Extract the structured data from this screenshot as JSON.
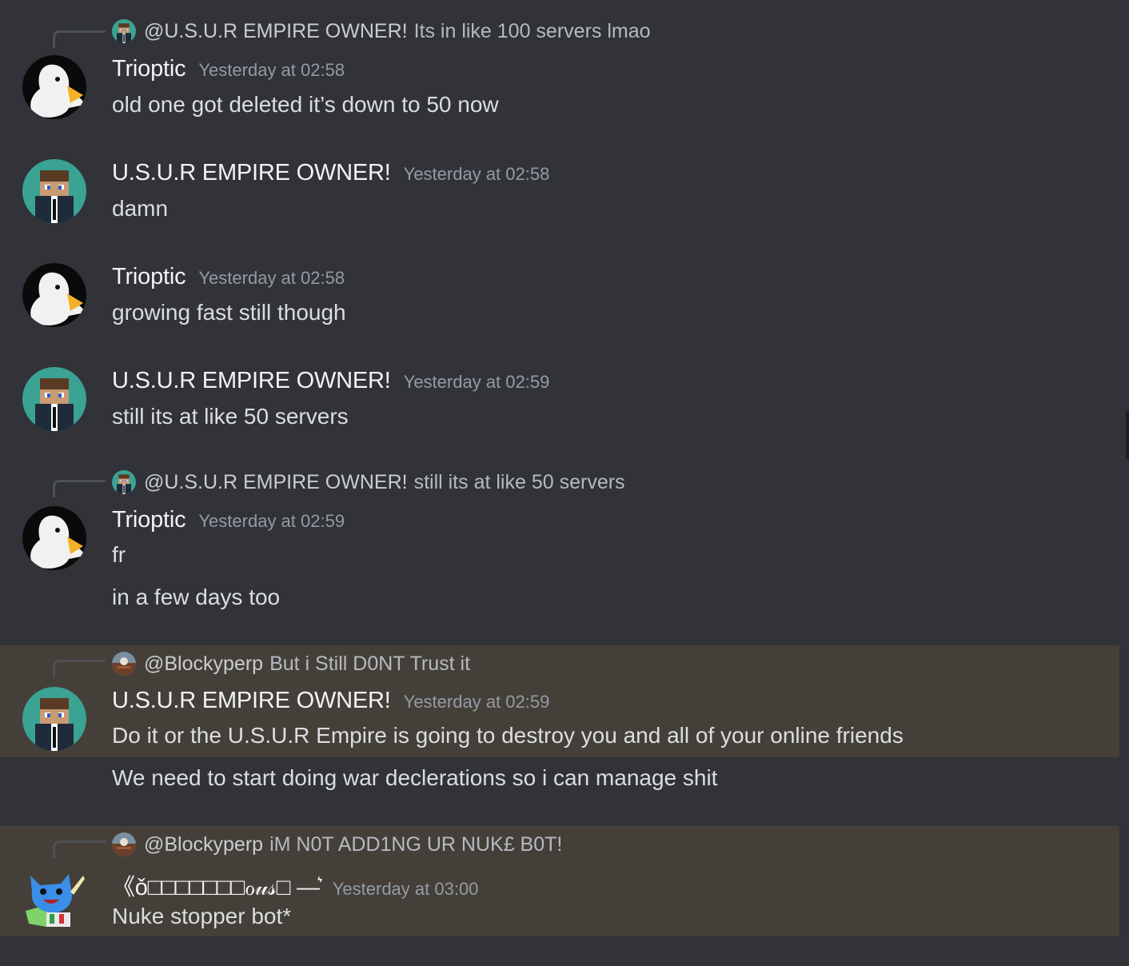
{
  "messages": [
    {
      "reply": {
        "mention": "@U.S.U.R EMPIRE OWNER!",
        "text": "Its in like 100 servers lmao",
        "avatar": "steve-avatar"
      },
      "author": "Trioptic",
      "timestamp": "Yesterday at 02:58",
      "avatar": "duck-avatar",
      "lines": [
        "old one got deleted it’s down to 50 now"
      ]
    },
    {
      "author": "U.S.U.R EMPIRE OWNER!",
      "timestamp": "Yesterday at 02:58",
      "avatar": "steve-avatar",
      "lines": [
        "damn"
      ]
    },
    {
      "author": "Trioptic",
      "timestamp": "Yesterday at 02:58",
      "avatar": "duck-avatar",
      "lines": [
        "growing fast still though"
      ]
    },
    {
      "author": "U.S.U.R EMPIRE OWNER!",
      "timestamp": "Yesterday at 02:59",
      "avatar": "steve-avatar",
      "lines": [
        "still its at like 50 servers"
      ]
    },
    {
      "reply": {
        "mention": "@U.S.U.R EMPIRE OWNER!",
        "text": "still its at like 50 servers",
        "avatar": "steve-avatar"
      },
      "author": "Trioptic",
      "timestamp": "Yesterday at 02:59",
      "avatar": "duck-avatar",
      "lines": [
        "fr",
        "in a few days too"
      ]
    },
    {
      "reply": {
        "mention": "@Blockyperp",
        "text": "But i Still D0NT Trust it",
        "avatar": "landscape-avatar"
      },
      "author": "U.S.U.R EMPIRE OWNER!",
      "timestamp": "Yesterday at 02:59",
      "avatar": "steve-avatar",
      "lines": [
        "Do it or the U.S.U.R Empire is going to destroy you and all of your online friends",
        "We need to start doing war declerations so i can manage shit"
      ]
    },
    {
      "reply": {
        "mention": "@Blockyperp",
        "text": "iM N0T ADD1NG UR NUK£ B0T!",
        "avatar": "landscape-avatar"
      },
      "author": "《ǒ□□□□□□□ℴ𝓊𝓈□ —͛ ",
      "timestamp": "Yesterday at 03:00",
      "avatar": "blue-cat-avatar",
      "lines": [
        "Nuke stopper bot*"
      ]
    }
  ]
}
